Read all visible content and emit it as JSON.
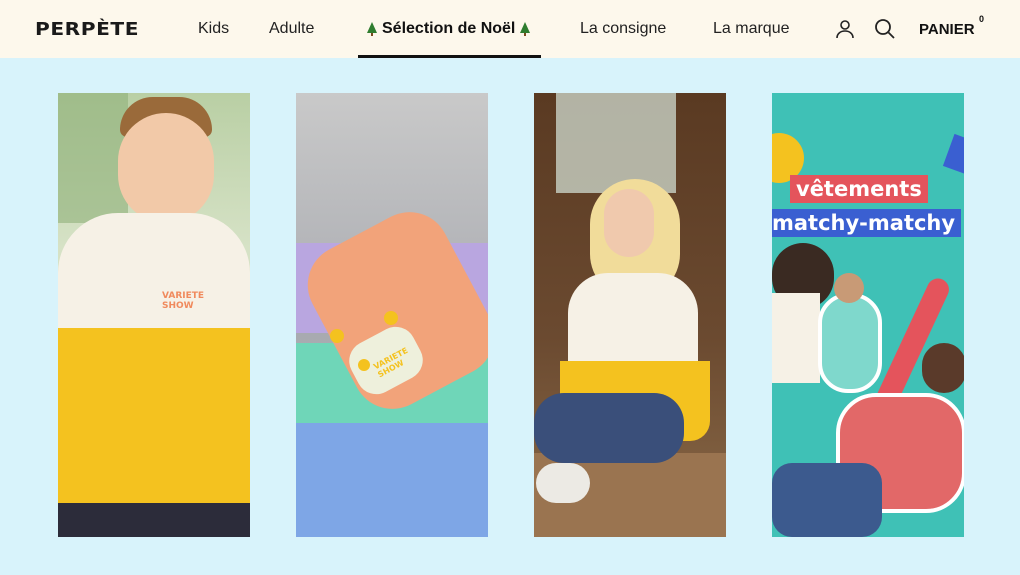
{
  "header": {
    "logo": "PERPÈTE",
    "nav": [
      {
        "label": "Kids"
      },
      {
        "label": "Adulte"
      },
      {
        "label": "Sélection de Noël"
      },
      {
        "label": "La consigne"
      },
      {
        "label": "La marque"
      }
    ],
    "cart_label": "PANIER",
    "cart_count": "0"
  },
  "cards": [
    {
      "badge": "VARIETE SHOW",
      "icon": "kid-sweatshirt-photo"
    },
    {
      "badge": "VARIETE SHOW",
      "icon": "fanny-pack-photo"
    },
    {
      "icon": "woman-sweatshirt-photo"
    },
    {
      "promo_line_1": "vêtements",
      "promo_line_2": "matchy-matchy",
      "icon": "family-promo-photo"
    }
  ],
  "colors": {
    "header_bg": "#fdf8ec",
    "page_bg": "#d8f3fb",
    "accent_yellow": "#f4c21f",
    "accent_red": "#e4545c",
    "promo_teal": "#3fc1b6",
    "promo_blue": "#3a5fd1"
  }
}
